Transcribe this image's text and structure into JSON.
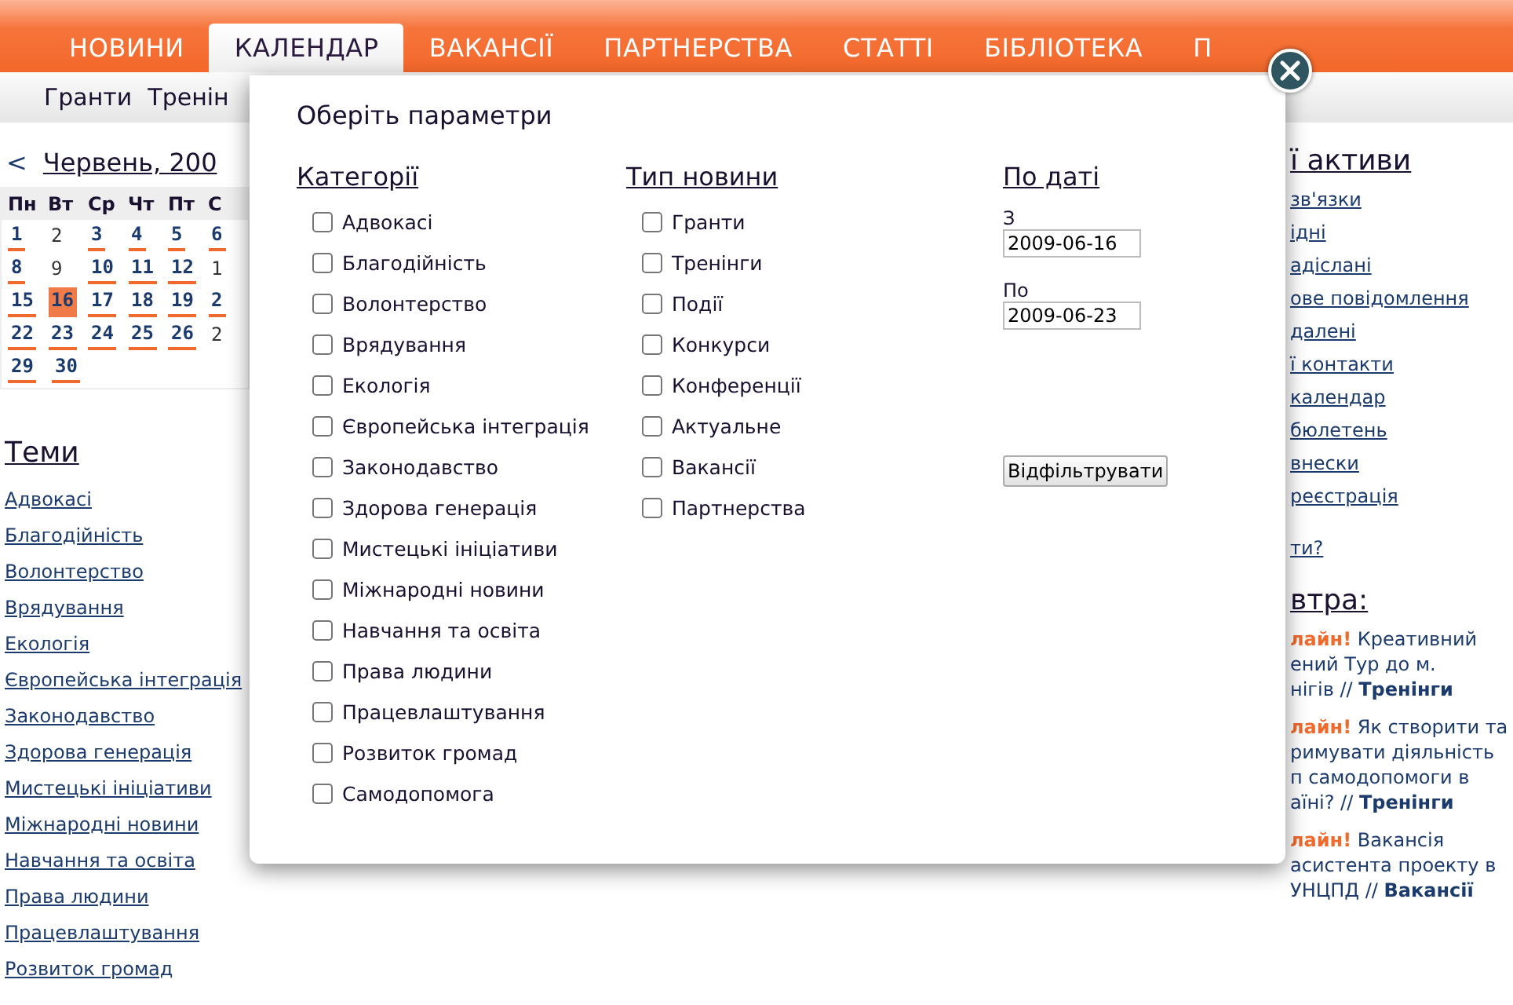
{
  "nav": [
    {
      "label": "НОВИНИ",
      "selected": false
    },
    {
      "label": "КАЛЕНДАР",
      "selected": true
    },
    {
      "label": "ВАКАНСІЇ",
      "selected": false
    },
    {
      "label": "ПАРТНЕРСТВА",
      "selected": false
    },
    {
      "label": "СТАТТІ",
      "selected": false
    },
    {
      "label": "БІБЛІОТЕКА",
      "selected": false
    },
    {
      "label": "П",
      "selected": false
    }
  ],
  "subnav": [
    "Гранти",
    "Тренін"
  ],
  "calendar": {
    "prev": "<",
    "month": "Червень, 200",
    "weekdays": [
      "Пн",
      "Вт",
      "Ср",
      "Чт",
      "Пт",
      "С"
    ],
    "weeks": [
      [
        {
          "day": "1",
          "events": true,
          "selected": false
        },
        {
          "day": "2",
          "events": false,
          "selected": false
        },
        {
          "day": "3",
          "events": true,
          "selected": false
        },
        {
          "day": "4",
          "events": true,
          "selected": false
        },
        {
          "day": "5",
          "events": true,
          "selected": false
        },
        {
          "day": "6",
          "events": true,
          "selected": false
        }
      ],
      [
        {
          "day": "8",
          "events": true,
          "selected": false
        },
        {
          "day": "9",
          "events": false,
          "selected": false
        },
        {
          "day": "10",
          "events": true,
          "selected": false
        },
        {
          "day": "11",
          "events": true,
          "selected": false
        },
        {
          "day": "12",
          "events": true,
          "selected": false
        },
        {
          "day": "1",
          "events": false,
          "selected": false
        }
      ],
      [
        {
          "day": "15",
          "events": true,
          "selected": false
        },
        {
          "day": "16",
          "events": true,
          "selected": true
        },
        {
          "day": "17",
          "events": true,
          "selected": false
        },
        {
          "day": "18",
          "events": true,
          "selected": false
        },
        {
          "day": "19",
          "events": true,
          "selected": false
        },
        {
          "day": "2",
          "events": true,
          "selected": false
        }
      ],
      [
        {
          "day": "22",
          "events": true,
          "selected": false
        },
        {
          "day": "23",
          "events": true,
          "selected": false
        },
        {
          "day": "24",
          "events": true,
          "selected": false
        },
        {
          "day": "25",
          "events": true,
          "selected": false
        },
        {
          "day": "26",
          "events": true,
          "selected": false
        },
        {
          "day": "2",
          "events": false,
          "selected": false
        }
      ],
      [
        {
          "day": "29",
          "events": true,
          "selected": false
        },
        {
          "day": "30",
          "events": true,
          "selected": false
        }
      ]
    ]
  },
  "topics": {
    "title": "Теми",
    "items": [
      "Адвокасі",
      "Благодійність",
      "Волонтерство",
      "Врядування",
      "Екологія",
      "Європейська інтеграція",
      "Законодавство",
      "Здорова генерація",
      "Мистецькі ініціативи",
      "Міжнародні новини",
      "Навчання та освіта",
      "Права людини",
      "Працевлаштування",
      "Розвиток громад"
    ]
  },
  "right": {
    "title": "ї активи",
    "links": [
      "зв'язки",
      "ідні",
      "адіслані",
      "ове повідомлення",
      "далені",
      "ї контакти",
      "календар",
      "бюлетень",
      "внески",
      "реєстрація"
    ],
    "question": "ти?",
    "news_title": "втра:",
    "news": [
      {
        "flag": "лайн!",
        "lines": [
          "Креативний",
          "ений Тур до м.",
          "нігів //"
        ],
        "category": "Тренінги"
      },
      {
        "flag": "лайн!",
        "lines": [
          "Як створити та",
          "римувати діяльність",
          "п самодопомоги в",
          "аїні? //"
        ],
        "category": "Тренінги"
      },
      {
        "flag": "лайн!",
        "lines": [
          "Вакансія",
          "асистента проекту в",
          "УНЦПД //"
        ],
        "category": "Вакансії"
      }
    ]
  },
  "modal": {
    "title": "Оберіть параметри",
    "categories": {
      "title": "Категорії",
      "items": [
        {
          "label": "Адвокасі",
          "checked": false
        },
        {
          "label": "Благодійність",
          "checked": false
        },
        {
          "label": "Волонтерство",
          "checked": false
        },
        {
          "label": "Врядування",
          "checked": false
        },
        {
          "label": "Екологія",
          "checked": false
        },
        {
          "label": "Європейська інтеграція",
          "checked": false
        },
        {
          "label": "Законодавство",
          "checked": false
        },
        {
          "label": "Здорова генерація",
          "checked": false
        },
        {
          "label": "Мистецькі ініціативи",
          "checked": false
        },
        {
          "label": "Міжнародні новини",
          "checked": false
        },
        {
          "label": "Навчання та освіта",
          "checked": false
        },
        {
          "label": "Права людини",
          "checked": false
        },
        {
          "label": "Працевлаштування",
          "checked": false
        },
        {
          "label": "Розвиток громад",
          "checked": false
        },
        {
          "label": "Самодопомога",
          "checked": false
        }
      ]
    },
    "types": {
      "title": "Тип новини",
      "items": [
        {
          "label": "Гранти",
          "checked": false
        },
        {
          "label": "Тренінги",
          "checked": false
        },
        {
          "label": "Події",
          "checked": false
        },
        {
          "label": "Конкурси",
          "checked": false
        },
        {
          "label": "Конференції",
          "checked": false
        },
        {
          "label": "Актуальне",
          "checked": false
        },
        {
          "label": "Вакансії",
          "checked": false
        },
        {
          "label": "Партнерства",
          "checked": false
        }
      ]
    },
    "dates": {
      "title": "По даті",
      "from_label": "З",
      "from": "2009-06-16",
      "to_label": "По",
      "to": "2009-06-23"
    },
    "button": "Відфільтрувати"
  }
}
